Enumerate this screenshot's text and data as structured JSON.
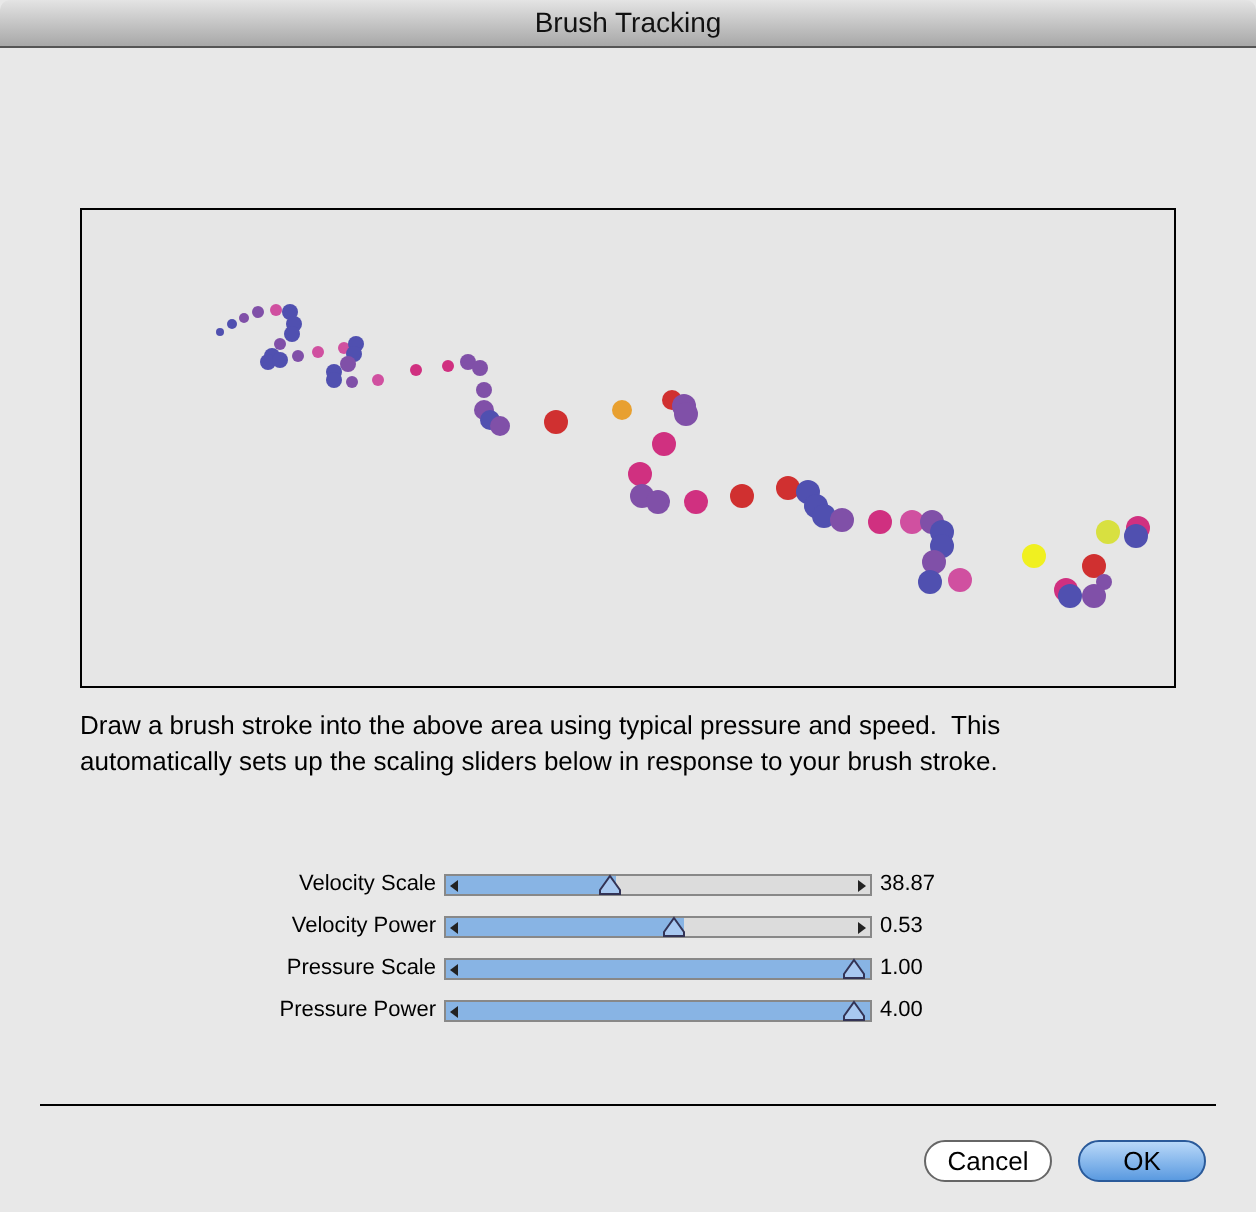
{
  "window": {
    "title": "Brush Tracking"
  },
  "instructions": "Draw a brush stroke into the above area using typical pressure and speed.  This automatically sets up the scaling sliders below in response to your brush stroke.",
  "sliders": [
    {
      "label": "Velocity Scale",
      "level": 0.4,
      "reading": "38.87"
    },
    {
      "label": "Velocity Power",
      "level": 0.56,
      "reading": "0.53"
    },
    {
      "label": "Pressure Scale",
      "level": 1,
      "reading": "1.00"
    },
    {
      "label": "Pressure Power",
      "level": 1,
      "reading": "4.00"
    }
  ],
  "buttons": [
    {
      "label": "Cancel",
      "kind": "default"
    },
    {
      "label": "OK",
      "kind": "primary"
    }
  ]
}
